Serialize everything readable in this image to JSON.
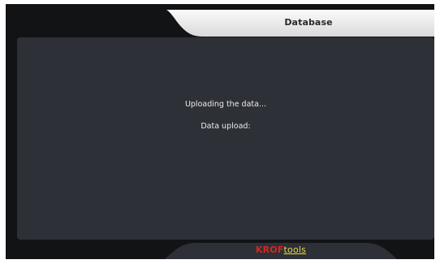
{
  "header": {
    "title": "Database"
  },
  "dialog": {
    "status_message": "Uploading the data...",
    "upload_label": "Data upload:",
    "upload_progress": 0
  },
  "footer": {
    "logo": {
      "part1": "KROF",
      "part2": "tools"
    }
  },
  "colors": {
    "screen_background": "#111315",
    "panel_background": "#2e3037",
    "text": "#ececec",
    "logo_red": "#d9251d",
    "logo_yellow": "#e9d84a",
    "tab_light": "#f2f2f2"
  }
}
